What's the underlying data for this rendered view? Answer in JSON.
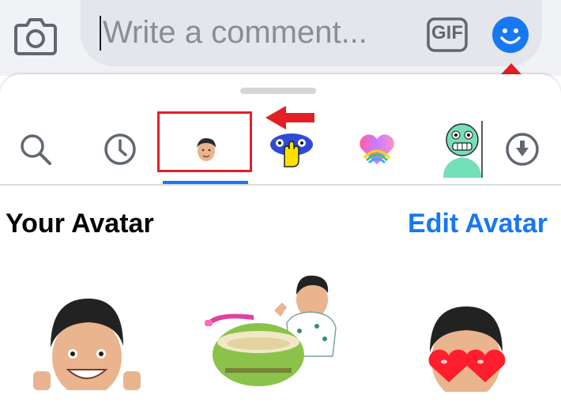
{
  "comment_bar": {
    "placeholder": "Write a comment...",
    "gif_label": "GIF"
  },
  "sticker_tray": {
    "tabs": [
      {
        "icon": "search-icon"
      },
      {
        "icon": "clock-icon"
      },
      {
        "icon": "avatar-face-icon",
        "selected": true
      },
      {
        "icon": "hand-waving-sticker-icon"
      },
      {
        "icon": "rainbow-heart-icon"
      },
      {
        "icon": "green-monster-sticker-icon"
      },
      {
        "icon": "download-icon"
      }
    ],
    "section_title": "Your Avatar",
    "edit_link": "Edit Avatar",
    "stickers": [
      {
        "icon": "avatar-thumbs-up-sticker"
      },
      {
        "icon": "avatar-coconut-drink-sticker"
      },
      {
        "icon": "avatar-heart-eyes-sticker"
      }
    ]
  },
  "colors": {
    "accent": "#1877f2",
    "annotation_red": "#e41e25",
    "input_bg": "#e4e6eb",
    "bar_bg": "#f0f2f5"
  }
}
